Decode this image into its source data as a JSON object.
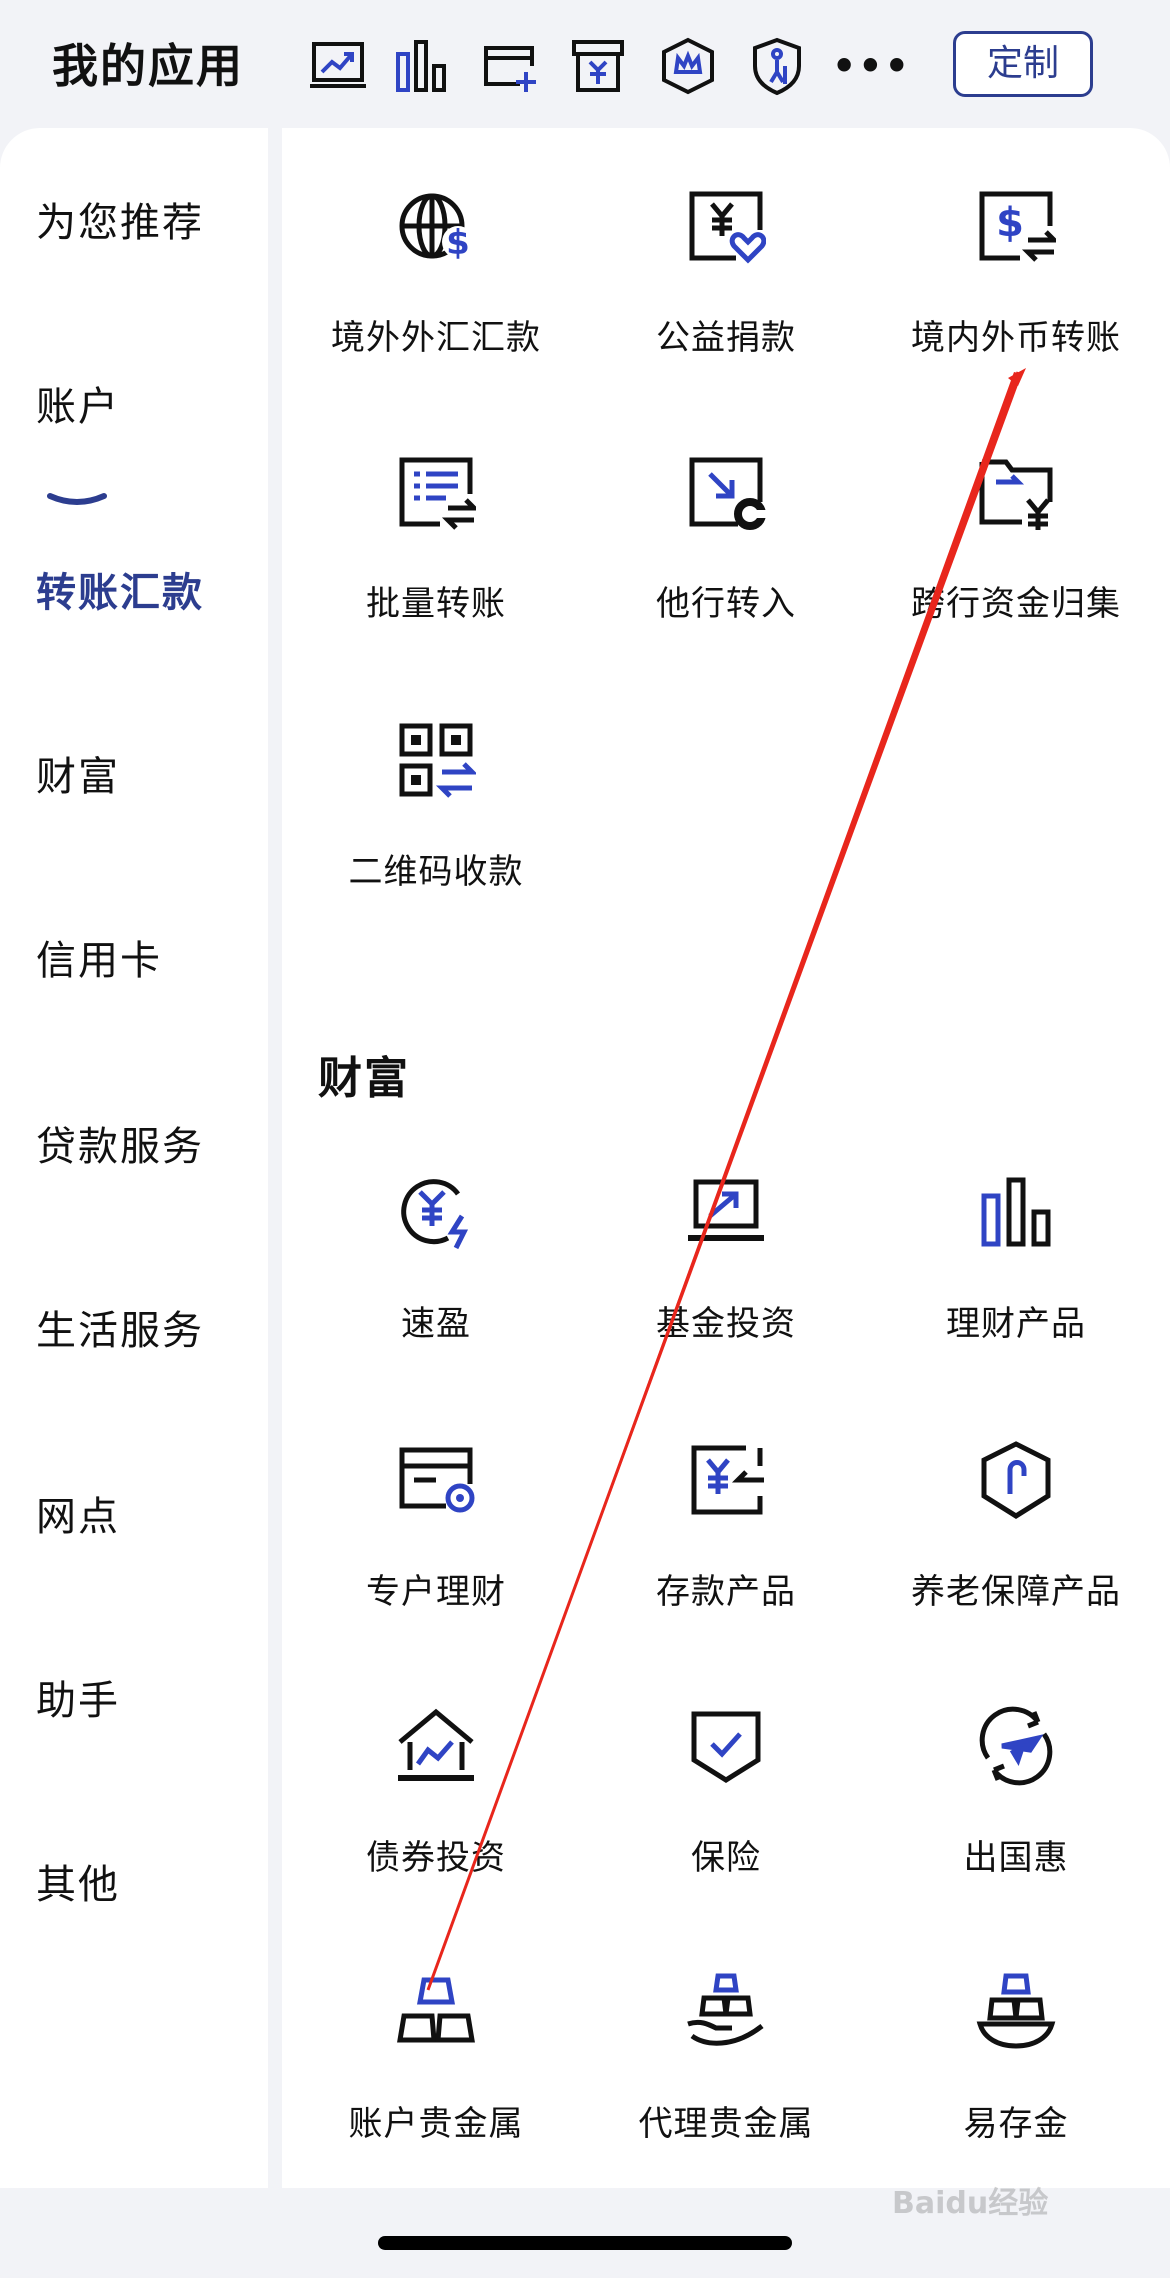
{
  "header": {
    "title": "我的应用",
    "more_label": "•••",
    "customize_label": "定制",
    "shortcuts": [
      "chart-up-icon",
      "bar-chart-icon",
      "add-card-icon",
      "yuan-box-icon",
      "crown-shield-icon",
      "elder-shield-icon"
    ]
  },
  "sidebar": {
    "items": [
      {
        "label": "为您推荐"
      },
      {
        "label": "账户"
      },
      {
        "label": "转账汇款",
        "active": true
      },
      {
        "label": "财富"
      },
      {
        "label": "信用卡"
      },
      {
        "label": "贷款服务"
      },
      {
        "label": "生活服务"
      },
      {
        "label": "网点"
      },
      {
        "label": "助手"
      },
      {
        "label": "其他"
      }
    ]
  },
  "transfer_apps": [
    {
      "label": "境外外汇汇款",
      "icon": "globe-dollar-icon"
    },
    {
      "label": "公益捐款",
      "icon": "yuan-heart-icon"
    },
    {
      "label": "境内外币转账",
      "icon": "dollar-transfer-icon"
    },
    {
      "label": "批量转账",
      "icon": "list-transfer-icon"
    },
    {
      "label": "他行转入",
      "icon": "inbound-transfer-icon"
    },
    {
      "label": "跨行资金归集",
      "icon": "folder-yuan-icon"
    },
    {
      "label": "二维码收款",
      "icon": "qr-transfer-icon"
    }
  ],
  "wealth_section": {
    "title": "财富",
    "apps": [
      {
        "label": "速盈",
        "icon": "yuan-lightning-icon"
      },
      {
        "label": "基金投资",
        "icon": "laptop-chart-icon"
      },
      {
        "label": "理财产品",
        "icon": "bar-chart-icon"
      },
      {
        "label": "专户理财",
        "icon": "card-coin-icon"
      },
      {
        "label": "存款产品",
        "icon": "yuan-deposit-icon"
      },
      {
        "label": "养老保障产品",
        "icon": "shield-cane-icon"
      },
      {
        "label": "债券投资",
        "icon": "bank-chart-icon"
      },
      {
        "label": "保险",
        "icon": "shield-check-icon"
      },
      {
        "label": "出国惠",
        "icon": "plane-cycle-icon"
      },
      {
        "label": "账户贵金属",
        "icon": "gold-bars-icon"
      },
      {
        "label": "代理贵金属",
        "icon": "hand-gold-icon"
      },
      {
        "label": "易存金",
        "icon": "bowl-gold-icon"
      }
    ]
  },
  "watermark": "Baidu经验",
  "colors": {
    "accent": "#2c3d8f",
    "icon_blue": "#2f44c4",
    "annotation": "#e8261c"
  }
}
